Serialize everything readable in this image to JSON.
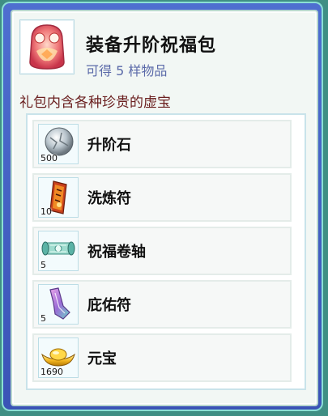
{
  "header": {
    "title": "装备升阶祝福包",
    "subtitle": "可得 5 样物品",
    "icon": "gift-pouch-icon"
  },
  "description": "礼包内含各种珍贵的虚宝",
  "items": [
    {
      "name": "升阶石",
      "count": "500",
      "icon": "upgrade-stone-icon"
    },
    {
      "name": "洗炼符",
      "count": "10",
      "icon": "refining-talisman-icon"
    },
    {
      "name": "祝福卷轴",
      "count": "5",
      "icon": "blessing-scroll-icon"
    },
    {
      "name": "庇佑符",
      "count": "5",
      "icon": "protection-talisman-icon"
    },
    {
      "name": "元宝",
      "count": "1690",
      "icon": "gold-ingot-icon"
    }
  ]
}
